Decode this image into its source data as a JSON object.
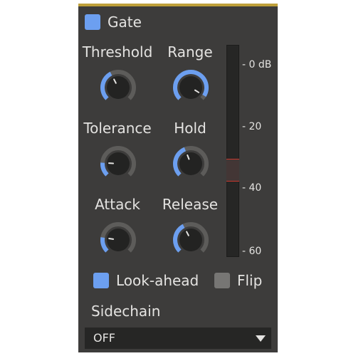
{
  "gate": {
    "label": "Gate",
    "enabled": true
  },
  "knobs": [
    {
      "id": "threshold",
      "label": "Threshold",
      "fraction": 0.4
    },
    {
      "id": "range",
      "label": "Range",
      "fraction": 0.95
    },
    {
      "id": "tolerance",
      "label": "Tolerance",
      "fraction": 0.18
    },
    {
      "id": "hold",
      "label": "Hold",
      "fraction": 0.42
    },
    {
      "id": "attack",
      "label": "Attack",
      "fraction": 0.2
    },
    {
      "id": "release",
      "label": "Release",
      "fraction": 0.4
    }
  ],
  "meter": {
    "ticks": [
      "- 0 dB",
      "- 20",
      "- 40",
      "- 60"
    ]
  },
  "options": {
    "lookahead": {
      "label": "Look-ahead",
      "checked": true
    },
    "flip": {
      "label": "Flip",
      "checked": false
    }
  },
  "sidechain": {
    "label": "Sidechain",
    "value": "OFF"
  },
  "colors": {
    "accent": "#6c9ff0",
    "panel": "#3d3c3b",
    "topbar": "#bea03a",
    "gate_marker": "#c7382f"
  }
}
